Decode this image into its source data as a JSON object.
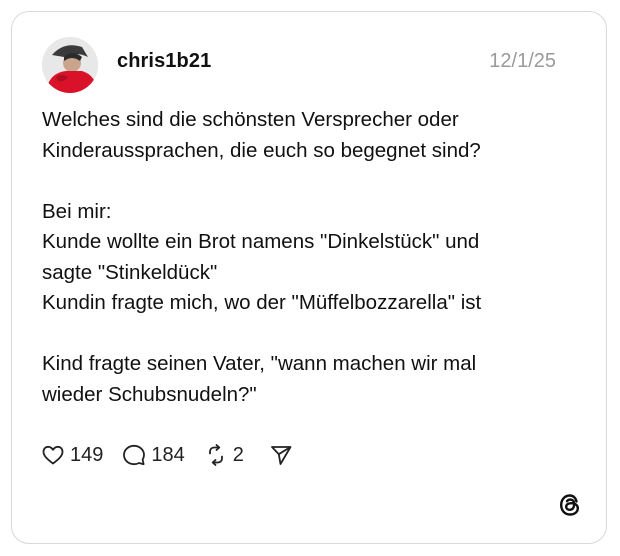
{
  "post": {
    "username": "chris1b21",
    "date": "12/1/25",
    "lines": [
      "Welches sind die schönsten Versprecher oder",
      "Kinderaussprachen, die euch so begegnet sind?",
      "",
      "Bei mir:",
      "Kunde wollte ein Brot namens \"Dinkelstück\" und",
      "sagte \"Stinkeldück\"",
      "Kundin fragte mich, wo der \"Müffelbozzarella\" ist",
      "",
      "Kind fragte seinen Vater, \"wann machen wir mal",
      "wieder Schubsnudeln?\""
    ]
  },
  "actions": {
    "likes": "149",
    "comments": "184",
    "reposts": "2"
  },
  "icons": {
    "like": "heart-icon",
    "comment": "speech-bubble-icon",
    "repost": "repost-arrows-icon",
    "share": "send-icon",
    "brand": "threads-logo-icon"
  }
}
